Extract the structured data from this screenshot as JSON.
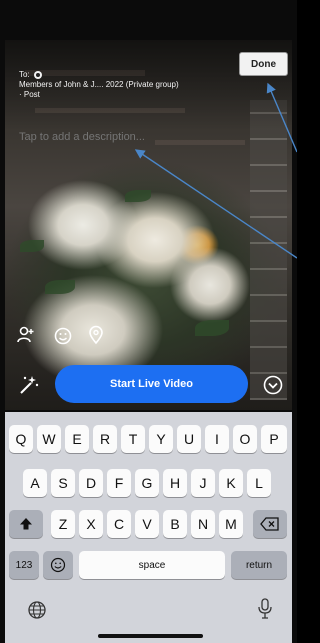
{
  "post_header": {
    "to_label": "To:",
    "audience_text": "Members of John & J.... 2022 (Private group)",
    "post_type": "· Post"
  },
  "done_label": "Done",
  "description_placeholder": "Tap to add a description...",
  "start_live_label": "Start Live Video",
  "keyboard": {
    "row1": [
      "Q",
      "W",
      "E",
      "R",
      "T",
      "Y",
      "U",
      "I",
      "O",
      "P"
    ],
    "row2": [
      "A",
      "S",
      "D",
      "F",
      "G",
      "H",
      "J",
      "K",
      "L"
    ],
    "row3": [
      "Z",
      "X",
      "C",
      "V",
      "B",
      "N",
      "M"
    ],
    "numbers_key": "123",
    "space_key": "space",
    "return_key": "return"
  },
  "colors": {
    "live_button": "#1d6ff2",
    "annotation_arrow": "#4a86c8"
  }
}
